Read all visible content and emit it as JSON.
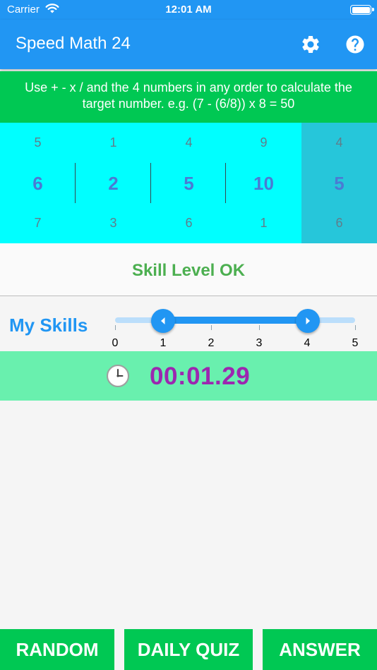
{
  "status_bar": {
    "carrier": "Carrier",
    "time": "12:01 AM"
  },
  "app_bar": {
    "title": "Speed Math 24",
    "settings_icon": "gear-icon",
    "help_icon": "help-icon"
  },
  "instructions": "Use + - x / and the 4 numbers in any order to calculate the target number.  e.g. (7 - (6/8)) x 8 = 50",
  "picker": {
    "columns": [
      {
        "above": "5",
        "selected": "6",
        "below": "7"
      },
      {
        "above": "1",
        "selected": "2",
        "below": "3"
      },
      {
        "above": "4",
        "selected": "5",
        "below": "6"
      },
      {
        "above": "9",
        "selected": "10",
        "below": "1"
      },
      {
        "above": "4",
        "selected": "5",
        "below": "6"
      }
    ]
  },
  "skill_level": "Skill Level OK",
  "skills": {
    "label": "My Skills",
    "ticks": [
      "0",
      "1",
      "2",
      "3",
      "4",
      "5"
    ],
    "range_low": 1,
    "range_high": 4
  },
  "timer": {
    "icon": "clock-icon",
    "value": "00:01.29"
  },
  "buttons": {
    "random": "RANDOM",
    "daily_quiz": "DAILY QUIZ",
    "answer": "ANSWER"
  },
  "colors": {
    "app_bar": "#2196f3",
    "instructions_bg": "#00c853",
    "picker_bg": "#00ffff",
    "picker_target_bg": "#26c6da",
    "skill_text": "#4caf50",
    "timer_bg": "#69f0ae",
    "timer_text": "#9c27b0",
    "button_bg": "#00c853"
  }
}
